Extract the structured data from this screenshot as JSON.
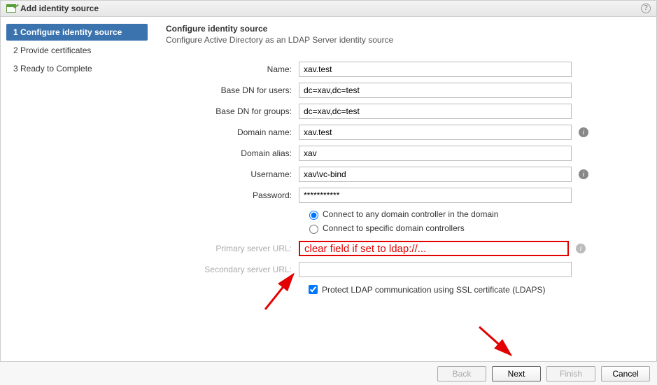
{
  "window": {
    "title": "Add identity source"
  },
  "steps": [
    {
      "label": "1  Configure identity source"
    },
    {
      "label": "2  Provide certificates"
    },
    {
      "label": "3  Ready to Complete"
    }
  ],
  "header": {
    "title": "Configure identity source",
    "subtitle": "Configure Active Directory as an LDAP Server identity source"
  },
  "fields": {
    "name": {
      "label": "Name:",
      "value": "xav.test"
    },
    "basednusers": {
      "label": "Base DN for users:",
      "value": "dc=xav,dc=test"
    },
    "basedngroups": {
      "label": "Base DN for groups:",
      "value": "dc=xav,dc=test"
    },
    "domain": {
      "label": "Domain name:",
      "value": "xav.test"
    },
    "alias": {
      "label": "Domain alias:",
      "value": "xav"
    },
    "username": {
      "label": "Username:",
      "value": "xav\\vc-bind"
    },
    "password": {
      "label": "Password:",
      "value": "***********"
    },
    "primary": {
      "label": "Primary server URL:",
      "value": "clear field if set to ldap://..."
    },
    "secondary": {
      "label": "Secondary server URL:",
      "value": ""
    }
  },
  "radios": {
    "any": "Connect to any domain controller in the domain",
    "specific": "Connect to specific domain controllers"
  },
  "checkbox": {
    "label": "Protect LDAP communication using SSL certificate (LDAPS)"
  },
  "buttons": {
    "back": "Back",
    "next": "Next",
    "finish": "Finish",
    "cancel": "Cancel"
  }
}
